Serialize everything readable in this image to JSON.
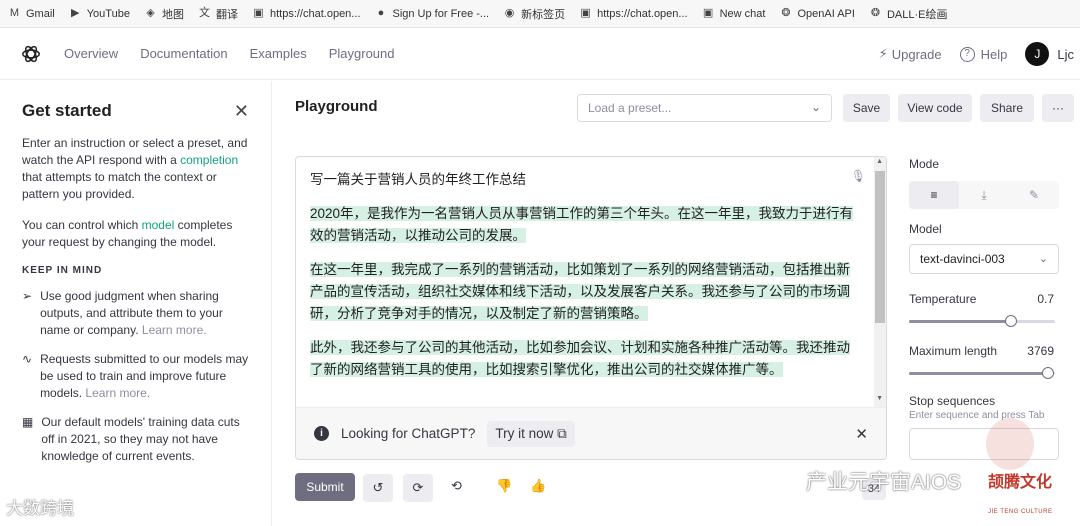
{
  "bookmarks": [
    {
      "icon": "gmail-icon",
      "glyph": "M",
      "label": "Gmail"
    },
    {
      "icon": "youtube-icon",
      "glyph": "▶",
      "label": "YouTube"
    },
    {
      "icon": "map-icon",
      "glyph": "◈",
      "label": "地图"
    },
    {
      "icon": "translate-icon",
      "glyph": "文",
      "label": "翻译"
    },
    {
      "icon": "page-icon",
      "glyph": "▣",
      "label": "https://chat.open..."
    },
    {
      "icon": "signup-icon",
      "glyph": "●",
      "label": "Sign Up for Free -..."
    },
    {
      "icon": "newtab-icon",
      "glyph": "◉",
      "label": "新标签页"
    },
    {
      "icon": "page-icon",
      "glyph": "▣",
      "label": "https://chat.open..."
    },
    {
      "icon": "chat-icon",
      "glyph": "▣",
      "label": "New chat"
    },
    {
      "icon": "openai-icon",
      "glyph": "❂",
      "label": "OpenAI API"
    },
    {
      "icon": "openai-icon",
      "glyph": "❂",
      "label": "DALL·E绘画"
    }
  ],
  "nav": {
    "links": [
      "Overview",
      "Documentation",
      "Examples",
      "Playground"
    ],
    "upgrade": "Upgrade",
    "help": "Help",
    "avatar_initial": "J",
    "user": "Ljc"
  },
  "sidebar": {
    "title": "Get started",
    "intro_a": "Enter an instruction or select a preset, and watch the API respond with a ",
    "intro_link": "completion",
    "intro_b": " that attempts to match the context or pattern you provided.",
    "model_a": "You can control which ",
    "model_link": "model",
    "model_b": " completes your request by changing the model.",
    "keep_in_mind": "KEEP IN MIND",
    "tips": [
      {
        "icon": "send-icon",
        "glyph": "➢",
        "text": "Use good judgment when sharing outputs, and attribute them to your name or company. ",
        "link": "Learn more."
      },
      {
        "icon": "activity-icon",
        "glyph": "∿",
        "text": "Requests submitted to our models may be used to train and improve future models. ",
        "link": "Learn more."
      },
      {
        "icon": "calendar-icon",
        "glyph": "▦",
        "text": "Our default models' training data cuts off in 2021, so they may not have knowledge of current events.",
        "link": ""
      }
    ]
  },
  "playground": {
    "title": "Playground",
    "preset_placeholder": "Load a preset...",
    "save": "Save",
    "view_code": "View code",
    "share": "Share",
    "more": "···",
    "prompt": "写一篇关于营销人员的年终工作总结",
    "paragraphs": [
      "2020年，是我作为一名营销人员从事营销工作的第三个年头。在这一年里，我致力于进行有效的营销活动，以推动公司的发展。",
      "在这一年里，我完成了一系列的营销活动，比如策划了一系列的网络营销活动，包括推出新产品的宣传活动，组织社交媒体和线下活动，以及发展客户关系。我还参与了公司的市场调研，分析了竞争对手的情况，以及制定了新的营销策略。",
      "此外，我还参与了公司的其他活动，比如参加会议、计划和实施各种推广活动等。我还推动了新的网络营销工具的使用，比如搜索引擎优化，推出公司的社交媒体推广等。"
    ],
    "banner_text": "Looking for ChatGPT?",
    "banner_link": "Try it now",
    "submit": "Submit",
    "token_count": "34"
  },
  "settings": {
    "mode_label": "Mode",
    "model_label": "Model",
    "model_value": "text-davinci-003",
    "temperature_label": "Temperature",
    "temperature_value": "0.7",
    "temperature_fraction": 0.7,
    "max_length_label": "Maximum length",
    "max_length_value": "3769",
    "max_length_fraction": 0.95,
    "stop_label": "Stop sequences",
    "stop_hint": "Enter sequence and press Tab"
  },
  "watermarks": {
    "left": "大数跨境",
    "right": "产业元宇宙AIOS",
    "brand": "颉腾文化",
    "brand_sub": "JIE TENG CULTURE"
  },
  "colors": {
    "accent": "#10a37f",
    "submit": "#6e6e80",
    "highlight": "#d7f0e4"
  }
}
